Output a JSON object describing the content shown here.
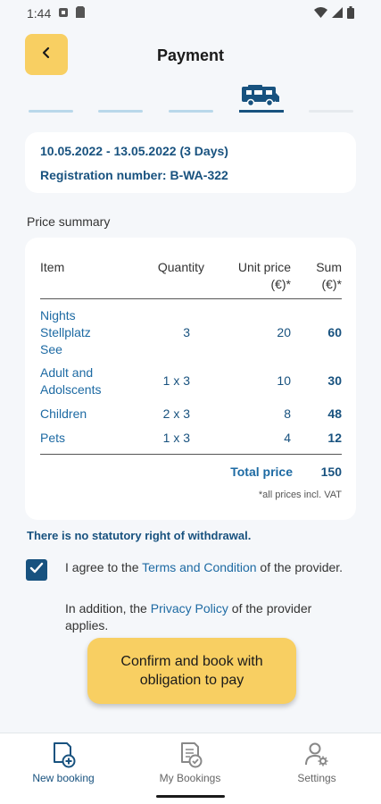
{
  "status_bar": {
    "time": "1:44"
  },
  "header": {
    "title": "Payment"
  },
  "booking_info": {
    "dates": "10.05.2022 - 13.05.2022  (3 Days)",
    "registration": "Registration number: B-WA-322"
  },
  "price_summary": {
    "section_label": "Price summary",
    "headers": {
      "item": "Item",
      "quantity": "Quantity",
      "unit_price_1": "Unit price",
      "unit_price_2": "(€)*",
      "sum_1": "Sum",
      "sum_2": "(€)*"
    },
    "rows": [
      {
        "item_1": "Nights",
        "item_2": "Stellplatz",
        "item_3": "See",
        "quantity": "3",
        "unit_price": "20",
        "sum": "60"
      },
      {
        "item_1": "Adult and",
        "item_2": "Adolscents",
        "quantity": "1 x 3",
        "unit_price": "10",
        "sum": "30"
      },
      {
        "item_1": "Children",
        "quantity": "2 x 3",
        "unit_price": "8",
        "sum": "48"
      },
      {
        "item_1": "Pets",
        "quantity": "1 x 3",
        "unit_price": "4",
        "sum": "12"
      }
    ],
    "total_label": "Total price",
    "total_value": "150",
    "vat_note": "*all prices incl. VAT"
  },
  "withdrawal_notice": "There is no statutory right of withdrawal.",
  "agreement": {
    "checked": true,
    "text_before": "I agree to the ",
    "terms_link": "Terms and Condition",
    "text_after": " of the provider.",
    "addition_before": "In addition, the ",
    "privacy_link": "Privacy Policy",
    "addition_after": " of the provider applies."
  },
  "confirm_button": {
    "line1": "Confirm and book with",
    "line2": "obligation to pay"
  },
  "bottom_nav": {
    "new_booking": "New booking",
    "my_bookings": "My Bookings",
    "settings": "Settings"
  },
  "colors": {
    "accent_yellow": "#f8cf62",
    "primary_blue": "#18527f",
    "link_blue": "#1d6aa3",
    "step_inactive": "#b9d8ea"
  },
  "icons": {
    "back": "chevron-left-icon",
    "step_vehicle": "camper-van-icon",
    "new_booking": "new-booking-icon",
    "my_bookings": "my-bookings-icon",
    "settings": "settings-user-icon"
  }
}
